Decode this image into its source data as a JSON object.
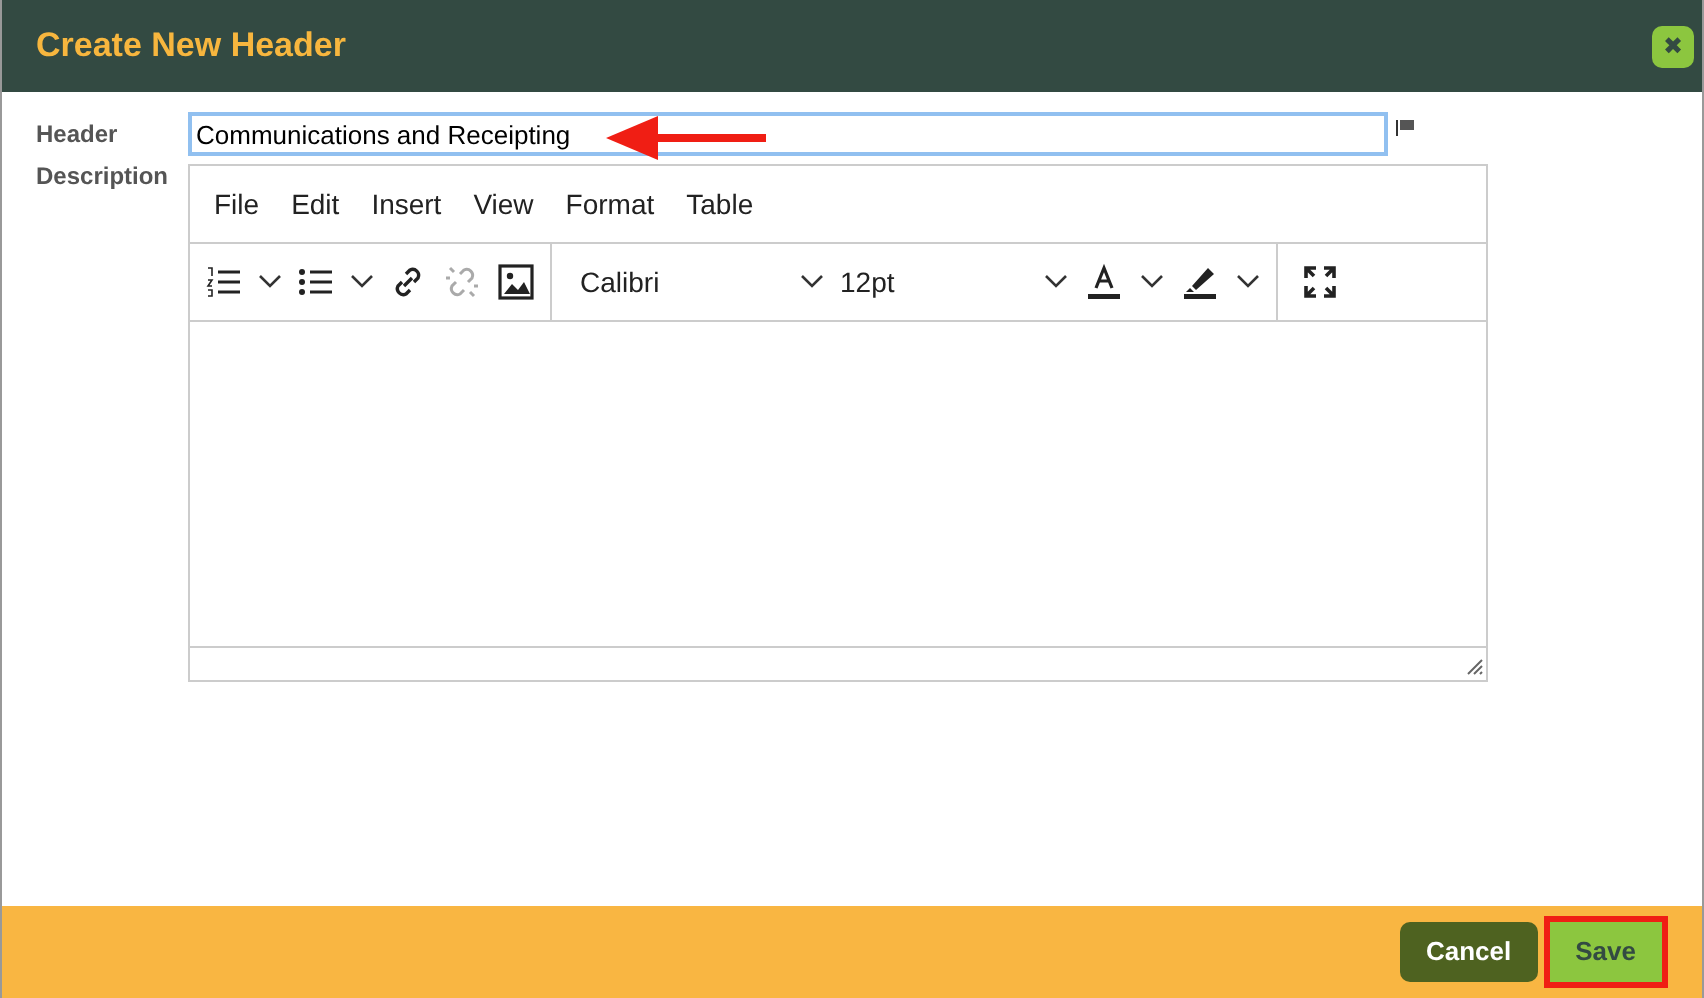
{
  "dialog": {
    "title": "Create New Header",
    "close": "✖"
  },
  "header_field": {
    "label": "Header",
    "value": "Communications and Receipting"
  },
  "description": {
    "label": "Description",
    "menu": [
      "File",
      "Edit",
      "Insert",
      "View",
      "Format",
      "Table"
    ],
    "font": "Calibri",
    "size": "12pt"
  },
  "buttons": [
    {
      "label": "Cancel",
      "kind": "cancel",
      "highlighted": false
    },
    {
      "label": "Save",
      "kind": "save",
      "highlighted": true
    }
  ]
}
